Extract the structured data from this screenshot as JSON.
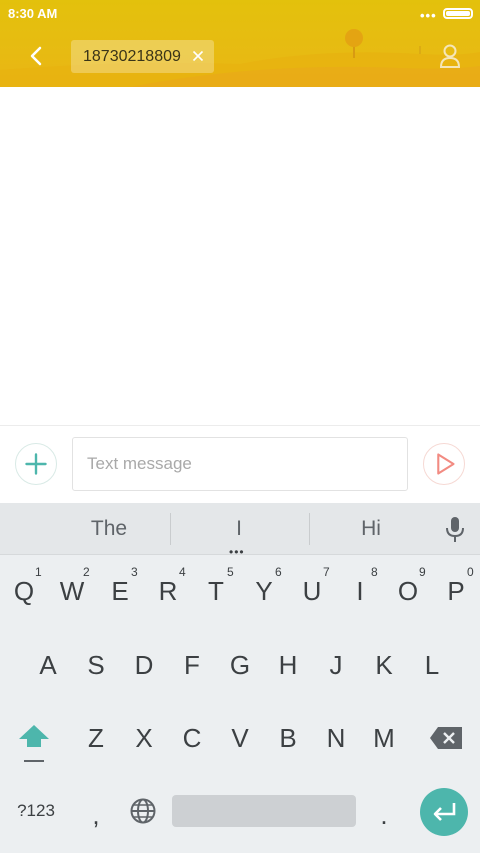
{
  "status": {
    "time": "8:30 AM",
    "dots": "•••"
  },
  "header": {
    "recipient": "18730218809"
  },
  "compose": {
    "placeholder": "Text message"
  },
  "keyboard": {
    "suggestions": [
      "The",
      "I",
      "Hi"
    ],
    "more_suggestions": "•••",
    "row1": [
      {
        "key": "Q",
        "hint": "1"
      },
      {
        "key": "W",
        "hint": "2"
      },
      {
        "key": "E",
        "hint": "3"
      },
      {
        "key": "R",
        "hint": "4"
      },
      {
        "key": "T",
        "hint": "5"
      },
      {
        "key": "Y",
        "hint": "6"
      },
      {
        "key": "U",
        "hint": "7"
      },
      {
        "key": "I",
        "hint": "8"
      },
      {
        "key": "O",
        "hint": "9"
      },
      {
        "key": "P",
        "hint": "0"
      }
    ],
    "row2": [
      "A",
      "S",
      "D",
      "F",
      "G",
      "H",
      "J",
      "K",
      "L"
    ],
    "row3": [
      "Z",
      "X",
      "C",
      "V",
      "B",
      "N",
      "M"
    ],
    "symbols_label": "?123",
    "comma": ",",
    "period": "."
  },
  "colors": {
    "header": "#e3c10c",
    "accent": "#4db6ac",
    "send": "#f28b82"
  }
}
